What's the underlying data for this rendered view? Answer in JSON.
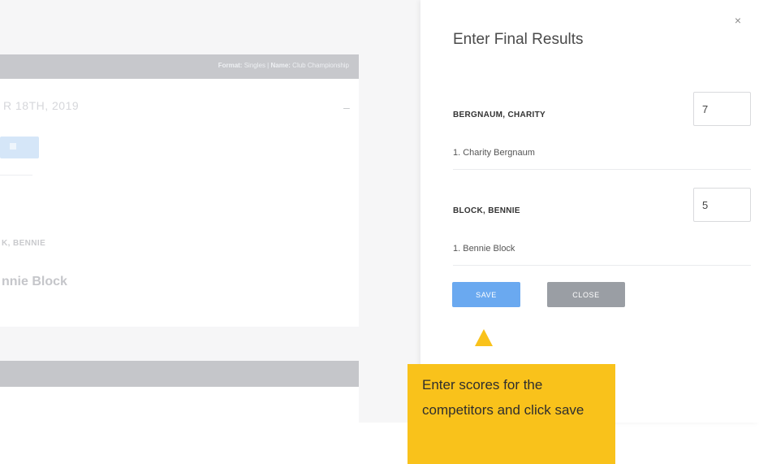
{
  "background": {
    "format_label": "Format:",
    "format_value": "Singles",
    "name_label": "Name:",
    "name_value": "Club Championship",
    "date": "R 18TH, 2019",
    "dash": "–",
    "competitor_name": "K, BENNIE",
    "competitor_member": "nnie Block"
  },
  "modal": {
    "title": "Enter Final Results",
    "close_symbol": "×",
    "competitors": [
      {
        "name": "BERGNAUM, CHARITY",
        "member": "1. Charity Bergnaum",
        "score": "7"
      },
      {
        "name": "BLOCK, BENNIE",
        "member": "1. Bennie Block",
        "score": "5"
      }
    ],
    "save_label": "SAVE",
    "close_label": "CLOSE"
  },
  "tooltip": {
    "text": "Enter scores for the competitors and click save"
  },
  "colors": {
    "save": "#6aa9f0",
    "close": "#9a9ea4",
    "tooltip": "#f9c21b"
  }
}
